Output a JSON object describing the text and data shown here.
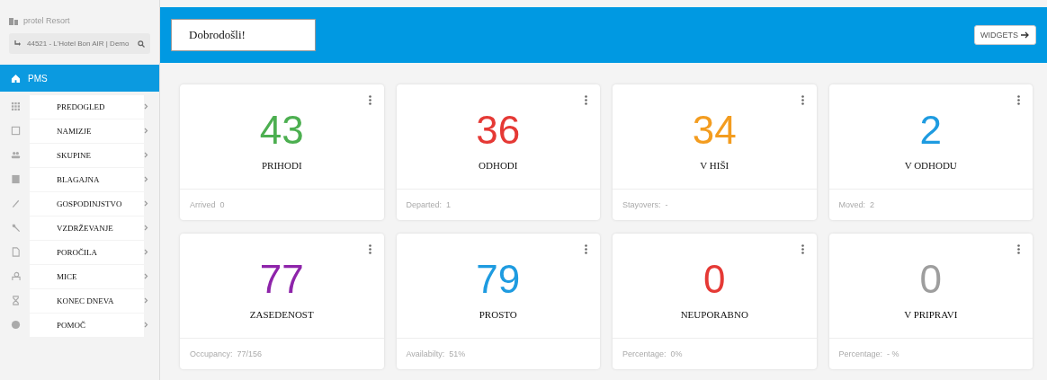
{
  "sidebar": {
    "brand": "protel Resort",
    "hotel_selector": "44521 - L'Hotel  Bon AIR | Demo",
    "items": [
      {
        "label": "PMS",
        "selected": true,
        "expandable": false
      },
      {
        "label": "PREDOGLED",
        "selected": false,
        "expandable": true
      },
      {
        "label": "NAMIZJE",
        "selected": false,
        "expandable": true
      },
      {
        "label": "SKUPINE",
        "selected": false,
        "expandable": true
      },
      {
        "label": "BLAGAJNA",
        "selected": false,
        "expandable": true
      },
      {
        "label": "GOSPODINJSTVO",
        "selected": false,
        "expandable": true
      },
      {
        "label": "VZDRŽEVANJE",
        "selected": false,
        "expandable": true
      },
      {
        "label": "POROČILA",
        "selected": false,
        "expandable": true
      },
      {
        "label": "MICE",
        "selected": false,
        "expandable": true
      },
      {
        "label": "KONEC DNEVA",
        "selected": false,
        "expandable": true
      },
      {
        "label": "POMOČ",
        "selected": false,
        "expandable": true
      }
    ]
  },
  "header": {
    "title": "Dobrodošli!",
    "button": "WIDGETS"
  },
  "cards": [
    {
      "value": "43",
      "label": "PRIHODI",
      "footer": "Arrived  0",
      "color": "#4caf50"
    },
    {
      "value": "36",
      "label": "ODHODI",
      "footer": "Departed:  1",
      "color": "#e53935"
    },
    {
      "value": "34",
      "label": "V HIŠI",
      "footer": "Stayovers:  -",
      "color": "#f39c1f"
    },
    {
      "value": "2",
      "label": "V ODHODU",
      "footer": "Moved:  2",
      "color": "#1e9be0"
    },
    {
      "value": "77",
      "label": "ZASEDENOST",
      "footer": "Occupancy:  77/156",
      "color": "#8e24aa"
    },
    {
      "value": "79",
      "label": "PROSTO",
      "footer": "Availabilty:  51%",
      "color": "#1e9be0"
    },
    {
      "value": "0",
      "label": "NEUPORABNO",
      "footer": "Percentage:  0%",
      "color": "#e53935"
    },
    {
      "value": "0",
      "label": "V PRIPRAVI",
      "footer": "Percentage:  - %",
      "color": "#9e9e9e"
    }
  ]
}
